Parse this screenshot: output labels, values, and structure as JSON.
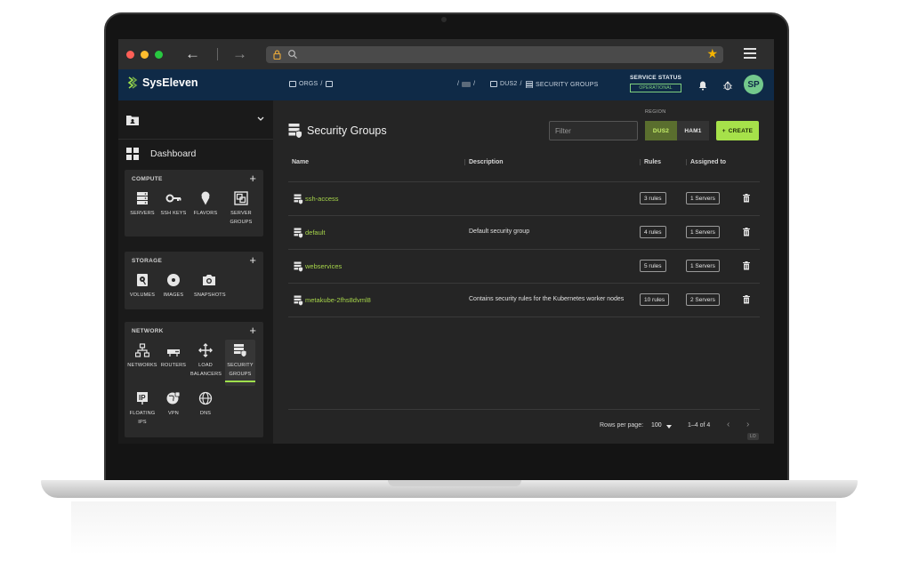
{
  "browser": {
    "colors": {
      "close": "#ff5f57",
      "minimize": "#febc2e",
      "maximize": "#28c840"
    }
  },
  "header": {
    "brand": "SysEleven",
    "crumb_orgs": "ORGS",
    "crumb_region": "DUS2",
    "crumb_page": "SECURITY GROUPS",
    "service_status_label": "SERVICE STATUS",
    "service_status_value": "OPERATIONAL",
    "avatar_initials": "SP"
  },
  "sidebar": {
    "dashboard_label": "Dashboard",
    "compute": {
      "title": "COMPUTE",
      "items": [
        "SERVERS",
        "SSH KEYS",
        "FLAVORS",
        "SERVER GROUPS"
      ]
    },
    "storage": {
      "title": "STORAGE",
      "items": [
        "VOLUMES",
        "IMAGES",
        "SNAPSHOTS"
      ]
    },
    "network": {
      "title": "NETWORK",
      "items": [
        "NETWORKS",
        "ROUTERS",
        "LOAD BALANCERS",
        "SECURITY GROUPS",
        "FLOATING IPS",
        "VPN",
        "DNS"
      ]
    },
    "active_item": "SECURITY GROUPS"
  },
  "main": {
    "title": "Security Groups",
    "filter_placeholder": "Filter",
    "region_label": "REGION",
    "regions": [
      "DUS2",
      "HAM1"
    ],
    "selected_region": "DUS2",
    "create_label": "CREATE",
    "columns": [
      "Name",
      "Description",
      "Rules",
      "Assigned to"
    ],
    "rows": [
      {
        "name": "ssh-access",
        "description": "",
        "rules": "3 rules",
        "assigned": "1 Servers"
      },
      {
        "name": "default",
        "description": "Default security group",
        "rules": "4 rules",
        "assigned": "1 Servers"
      },
      {
        "name": "webservices",
        "description": "",
        "rules": "5 rules",
        "assigned": "1 Servers"
      },
      {
        "name": "metakube-2fhs8dvml8",
        "description": "Contains security rules for the Kubernetes worker nodes",
        "rules": "10 rules",
        "assigned": "2 Servers"
      }
    ],
    "footer": {
      "rows_per_page_label": "Rows per page:",
      "rows_per_page": "100",
      "range": "1–4 of 4"
    },
    "version": "LO"
  },
  "colors": {
    "accent": "#a6e14a",
    "header_bg": "#0f2a47",
    "link": "#a6d44a"
  }
}
